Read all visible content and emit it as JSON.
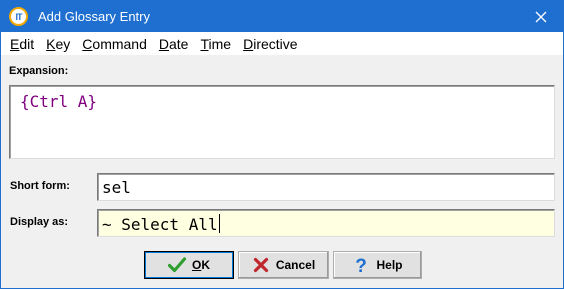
{
  "window": {
    "title": "Add Glossary Entry",
    "app_icon_text": "IT"
  },
  "menu": {
    "items": [
      {
        "label_ul": "E",
        "label_rest": "dit"
      },
      {
        "label_ul": "K",
        "label_rest": "ey"
      },
      {
        "label_ul": "C",
        "label_rest": "ommand"
      },
      {
        "label_ul": "D",
        "label_rest": "ate"
      },
      {
        "label_ul": "T",
        "label_rest": "ime"
      },
      {
        "label_ul": "D",
        "label_rest": "irective"
      }
    ]
  },
  "form": {
    "expansion_label": "Expansion:",
    "expansion_value": "{Ctrl A}",
    "short_form_label": "Short form:",
    "short_form_value": "sel",
    "display_as_label": "Display as:",
    "display_as_value": "~ Select All"
  },
  "buttons": {
    "ok": {
      "ul": "O",
      "rest": "K"
    },
    "cancel": {
      "label": "Cancel"
    },
    "help": {
      "label": "Help"
    }
  },
  "colors": {
    "titlebar": "#1e6fd0",
    "expansion_text": "#800080",
    "display_field_bg": "#ffffe1",
    "ok_check": "#2e9e2e",
    "cancel_x": "#c0272d",
    "help_q": "#1e6fd0"
  }
}
